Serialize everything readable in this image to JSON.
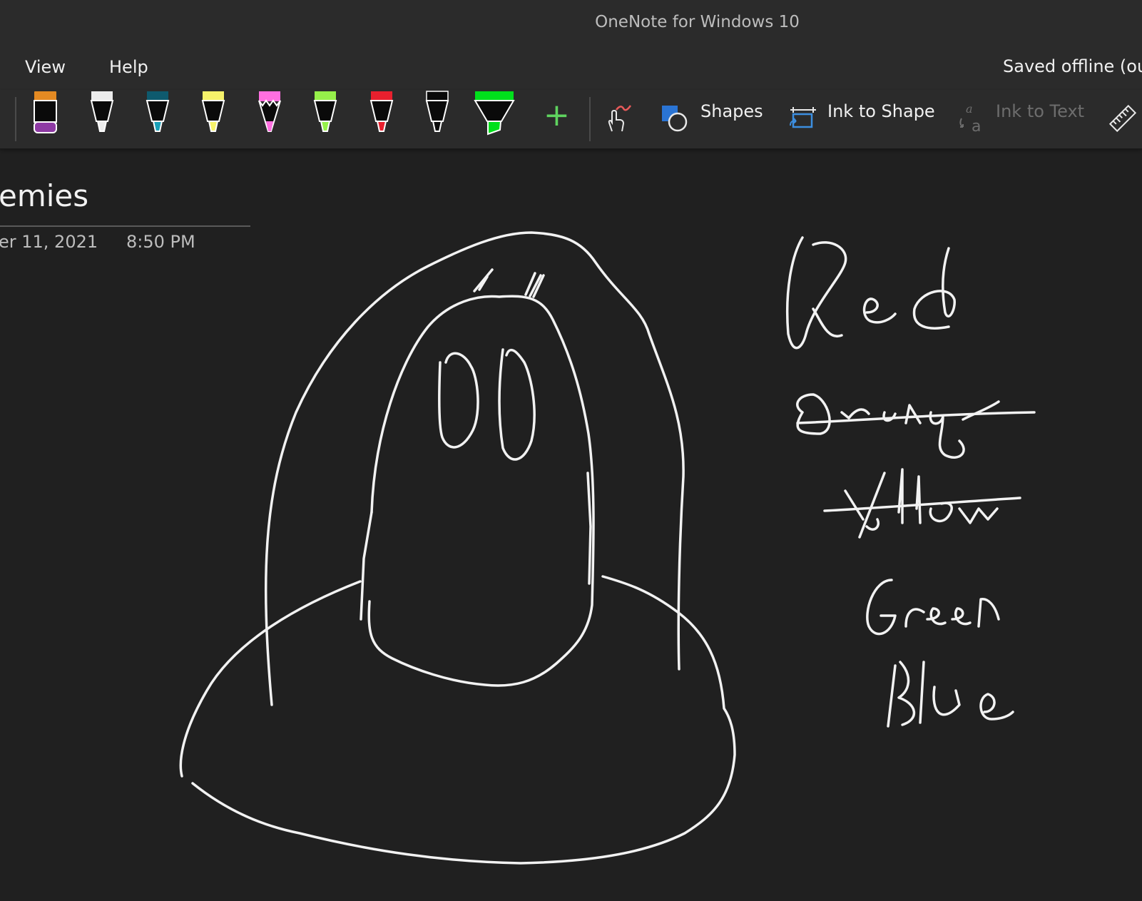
{
  "window": {
    "title": "OneNote for Windows 10"
  },
  "menu": {
    "items": [
      "View",
      "Help"
    ],
    "status": "Saved offline (out"
  },
  "ribbon": {
    "pens": [
      {
        "name": "eraser-tool",
        "color": "#e48a22",
        "accent": "#8e3aa4"
      },
      {
        "name": "pen-white",
        "color": "#ececec"
      },
      {
        "name": "pen-teal",
        "color": "#0e5a6e"
      },
      {
        "name": "pen-yellow",
        "color": "#f6f26a"
      },
      {
        "name": "pencil-pink",
        "color": "#ff6fe0"
      },
      {
        "name": "pen-lime",
        "color": "#96f04a"
      },
      {
        "name": "pen-red",
        "color": "#e8202e"
      },
      {
        "name": "pen-black",
        "color": "#0a0a0a"
      },
      {
        "name": "highlighter-green",
        "color": "#00e01c"
      }
    ],
    "add_pen_glyph": "+",
    "shapes_label": "Shapes",
    "ink_to_shape_label": "Ink to Shape",
    "ink_to_text_label": "Ink to Text"
  },
  "page": {
    "title": "emies",
    "date": "er 11, 2021",
    "time": "8:50 PM"
  },
  "ink": {
    "stroke_color": "#f2f2f2",
    "words": [
      "Red",
      "Orange",
      "Yellow",
      "Green",
      "Blue"
    ]
  }
}
